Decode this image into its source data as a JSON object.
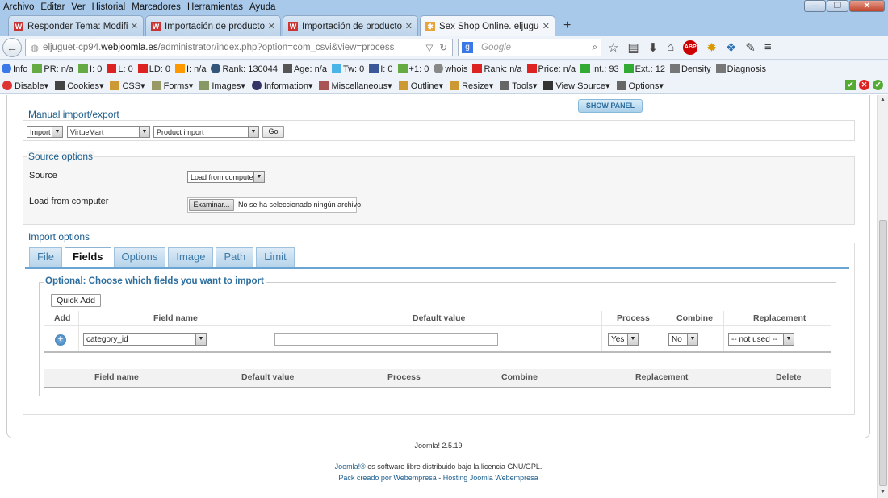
{
  "menubar": {
    "items": [
      "Archivo",
      "Editar",
      "Ver",
      "Historial",
      "Marcadores",
      "Herramientas",
      "Ayuda"
    ]
  },
  "window_controls": {
    "minimize": "—",
    "maximize": "❐",
    "close": "✕"
  },
  "tabs": [
    {
      "title": "Responder Tema: Modifica..."
    },
    {
      "title": "Importación de productos ..."
    },
    {
      "title": "Importación de productos ..."
    },
    {
      "title": "Sex Shop Online. eljuguete..."
    }
  ],
  "navbar": {
    "url_host_prefix": "eljuguet-cp94.",
    "url_host": "webjoomla.es",
    "url_path": "/administrator/index.php?option=com_csvi&view=process",
    "search_placeholder": "Google",
    "abp_label": "ABP"
  },
  "seobar": {
    "items": [
      "Info",
      "PR: n/a",
      "I: 0",
      "L: 0",
      "LD: 0",
      "I: n/a",
      "Rank: 130044",
      "Age: n/a",
      "Tw: 0",
      "I: 0",
      "+1: 0",
      "whois",
      "Rank: n/a",
      "Price: n/a",
      "Int.: 93",
      "Ext.: 12",
      "Density",
      "Diagnosis"
    ]
  },
  "devbar": {
    "items": [
      "Disable▾",
      "Cookies▾",
      "CSS▾",
      "Forms▾",
      "Images▾",
      "Information▾",
      "Miscellaneous▾",
      "Outline▾",
      "Resize▾",
      "Tools▾",
      "View Source▾",
      "Options▾"
    ]
  },
  "show_panel": "SHOW PANEL",
  "manual_import": {
    "legend": "Manual import/export",
    "action": "Import",
    "component": "VirtueMart",
    "template": "Product import",
    "go": "Go"
  },
  "source_options": {
    "legend": "Source options",
    "source_label": "Source",
    "source_value": "Load from computer",
    "load_label": "Load from computer",
    "browse_button": "Examinar...",
    "no_file": "No se ha seleccionado ningún archivo."
  },
  "import_options": {
    "legend": "Import options",
    "tabs": [
      "File",
      "Fields",
      "Options",
      "Image",
      "Path",
      "Limit"
    ],
    "active_tab": "Fields"
  },
  "fields": {
    "legend": "Optional: Choose which fields you want to import",
    "quick_add": "Quick Add",
    "headers": [
      "Add",
      "Field name",
      "Default value",
      "Process",
      "Combine",
      "Replacement"
    ],
    "row": {
      "add_icon": "+",
      "field_name": "category_id",
      "default_value": "",
      "process": "Yes",
      "combine": "No",
      "replacement": "-- not used --"
    },
    "table_headers": [
      "Field name",
      "Default value",
      "Process",
      "Combine",
      "Replacement",
      "Delete"
    ]
  },
  "footer": {
    "version": "Joomla! 2.5.19",
    "license_link": "Joomla!®",
    "license_text": " es software libre distribuido bajo la licencia GNU/GPL.",
    "pack_link": "Pack creado por Webempresa",
    "sep": " - ",
    "hosting_link": "Hosting Joomla Webempresa"
  },
  "colors": {
    "accent": "#1a5c8c",
    "tab_bar": "#a9c9ea",
    "link": "#1a5c8c"
  }
}
